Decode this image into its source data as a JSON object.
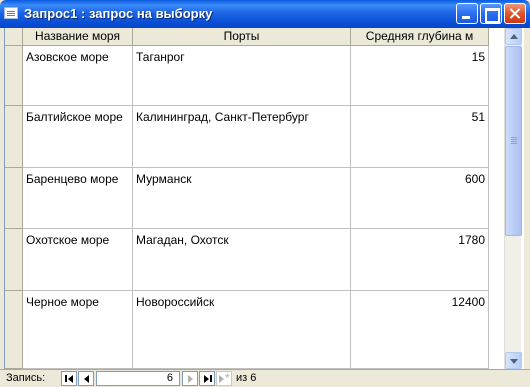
{
  "window": {
    "title": "Запрос1 : запрос на выборку"
  },
  "table": {
    "columns": [
      "Название моря",
      "Порты",
      "Средняя глубина м"
    ],
    "rows": [
      {
        "name": "Азовское море",
        "ports": "Таганрог",
        "depth": "15"
      },
      {
        "name": "Балтийское море",
        "ports": "Калининград, Санкт-Петербург",
        "depth": "51"
      },
      {
        "name": "Баренцево море",
        "ports": "Мурманск",
        "depth": "600"
      },
      {
        "name": "Охотское море",
        "ports": "Магадан, Охотск",
        "depth": "1780"
      },
      {
        "name": "Черное море",
        "ports": "Новороссийск",
        "depth": "12400"
      }
    ]
  },
  "navigation": {
    "label": "Запись:",
    "current_record": "6",
    "of_text": "из 6"
  },
  "colors": {
    "titlebar": "#0a4ed4",
    "chrome": "#ece9d8",
    "close_button": "#e0522a"
  }
}
